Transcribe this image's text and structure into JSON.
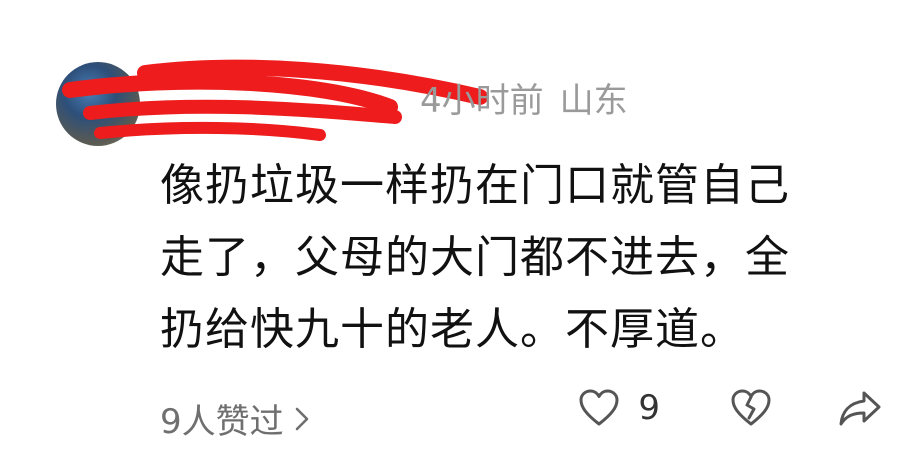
{
  "comment": {
    "meta": {
      "time_ago": "4小时前",
      "location": "山东"
    },
    "text_lines": [
      "像扔垃圾一样扔在门口就管自己",
      "走了，父母的大门都不进去，全",
      "扔给快九十的老人。不厚道。"
    ],
    "likes_link": "9人赞过",
    "like_count": "9",
    "icons": {
      "like": "heart-outline-icon",
      "dislike": "broken-heart-icon",
      "share": "share-arrow-icon",
      "chevron": "chevron-right-icon"
    },
    "colors": {
      "redaction": "#ee1c1c",
      "meta_text": "#9a9a9a",
      "body_text": "#111111",
      "icon": "#555555"
    }
  }
}
